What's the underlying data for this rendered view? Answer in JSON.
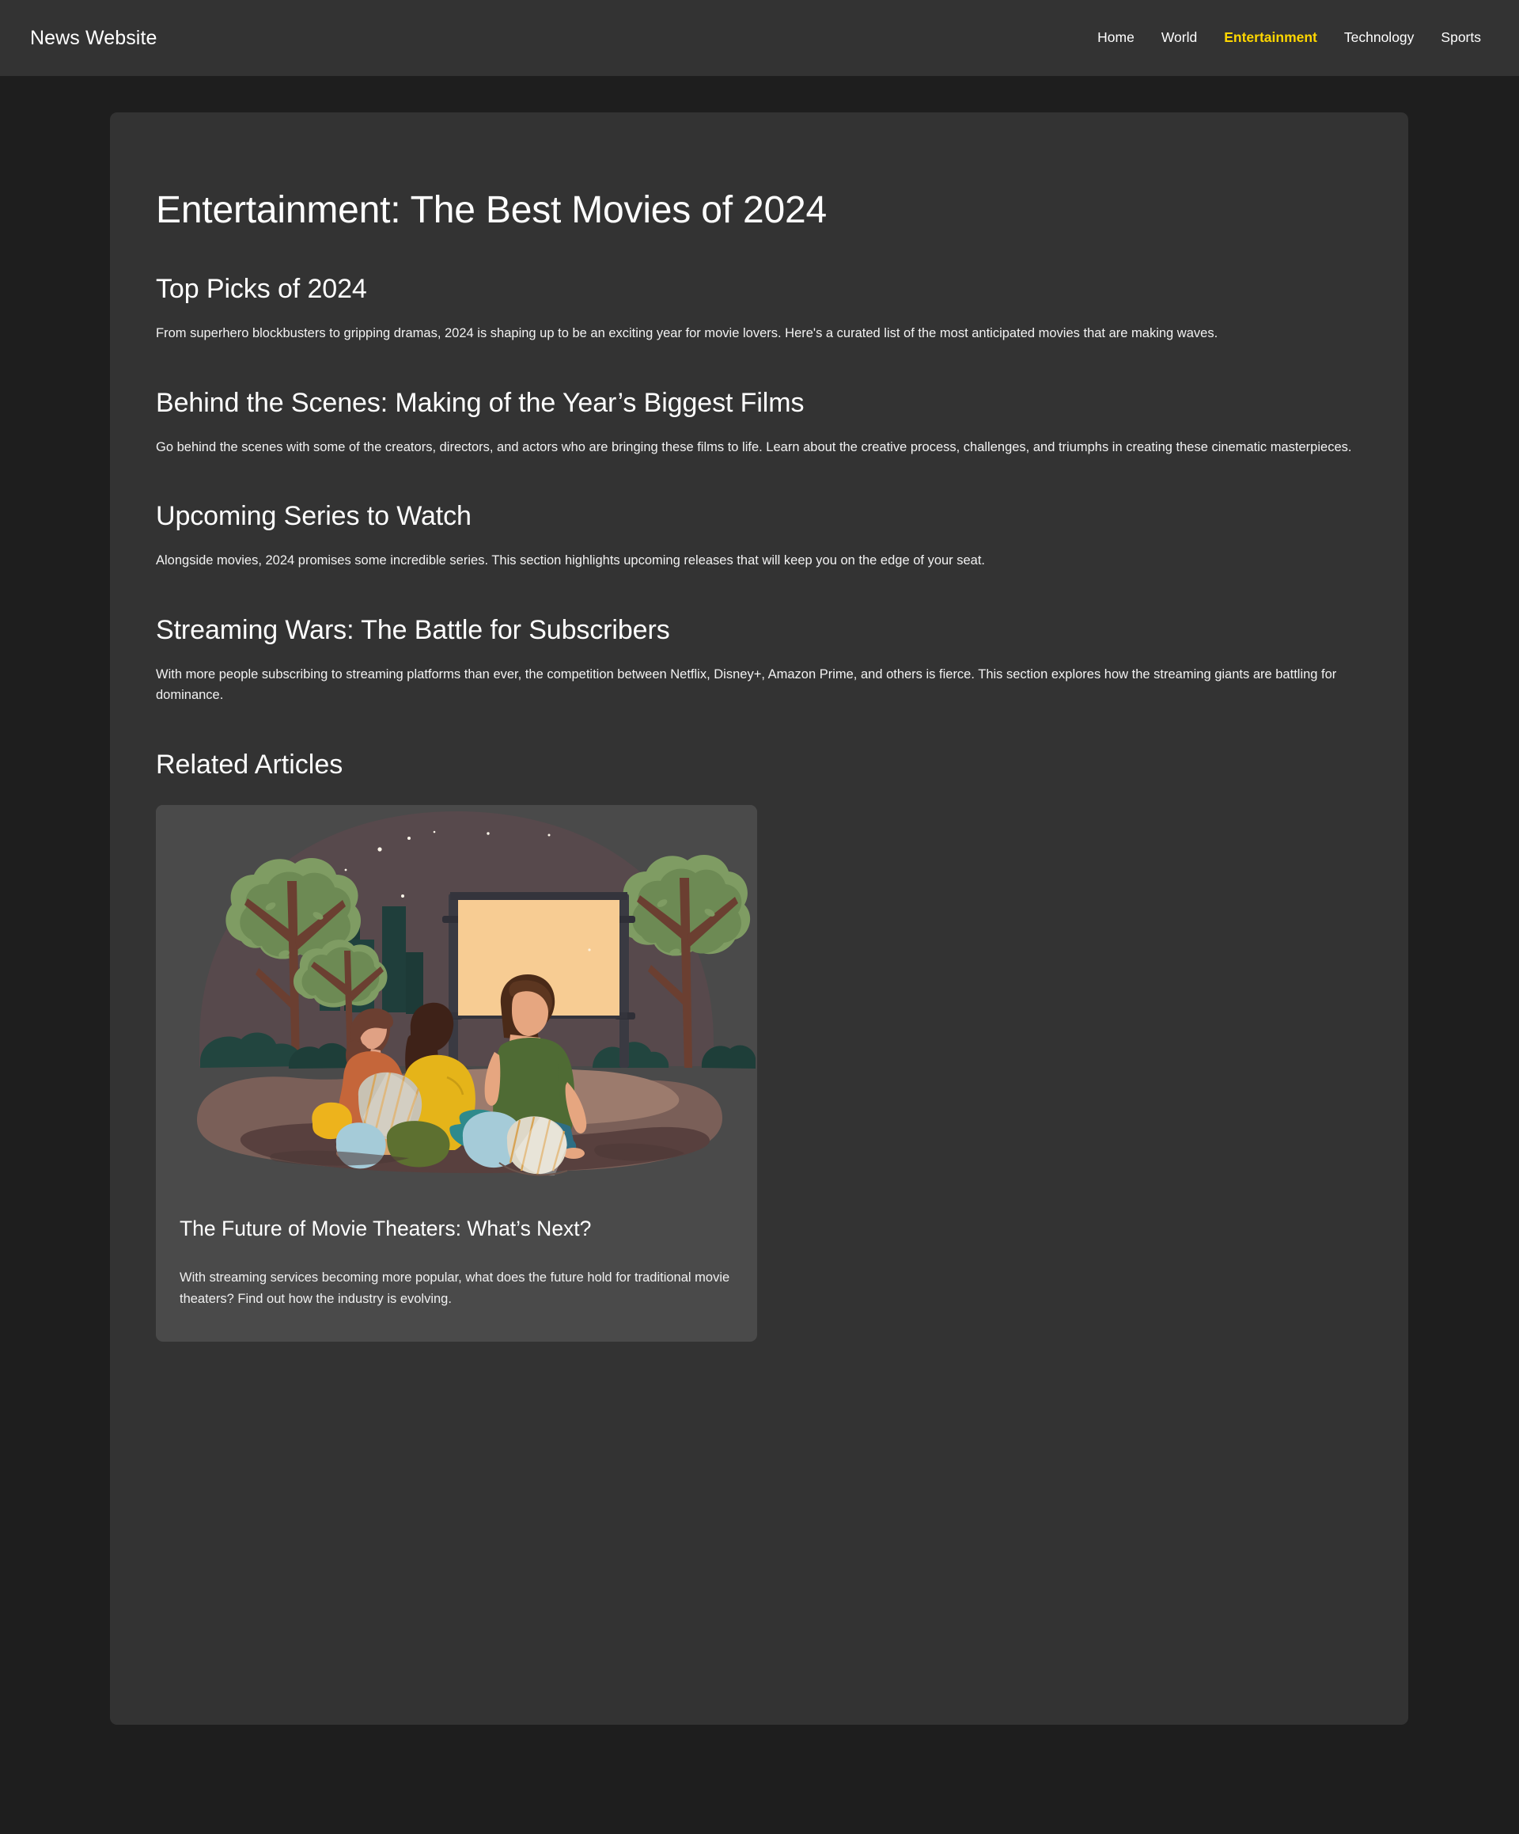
{
  "header": {
    "brand": "News Website",
    "nav": [
      {
        "label": "Home",
        "active": false
      },
      {
        "label": "World",
        "active": false
      },
      {
        "label": "Entertainment",
        "active": true
      },
      {
        "label": "Technology",
        "active": false
      },
      {
        "label": "Sports",
        "active": false
      }
    ]
  },
  "article": {
    "title": "Entertainment: The Best Movies of 2024",
    "sections": [
      {
        "heading": "Top Picks of 2024",
        "body": "From superhero blockbusters to gripping dramas, 2024 is shaping up to be an exciting year for movie lovers. Here's a curated list of the most anticipated movies that are making waves."
      },
      {
        "heading": "Behind the Scenes: Making of the Year’s Biggest Films",
        "body": "Go behind the scenes with some of the creators, directors, and actors who are bringing these films to life. Learn about the creative process, challenges, and triumphs in creating these cinematic masterpieces."
      },
      {
        "heading": "Upcoming Series to Watch",
        "body": "Alongside movies, 2024 promises some incredible series. This section highlights upcoming releases that will keep you on the edge of your seat."
      },
      {
        "heading": "Streaming Wars: The Battle for Subscribers",
        "body": "With more people subscribing to streaming platforms than ever, the competition between Netflix, Disney+, Amazon Prime, and others is fierce. This section explores how the streaming giants are battling for dominance."
      }
    ]
  },
  "related": {
    "heading": "Related Articles",
    "cards": [
      {
        "image_name": "outdoor-movie-night-illustration",
        "title": "The Future of Movie Theaters: What’s Next?",
        "excerpt": "With streaming services becoming more popular, what does the future hold for traditional movie theaters? Find out how the industry is evolving."
      }
    ]
  },
  "colors": {
    "page_background": "#1e1e1e",
    "surface": "#333333",
    "card_surface": "#4a4a4a",
    "accent": "#ffd700",
    "text": "#ffffff"
  }
}
